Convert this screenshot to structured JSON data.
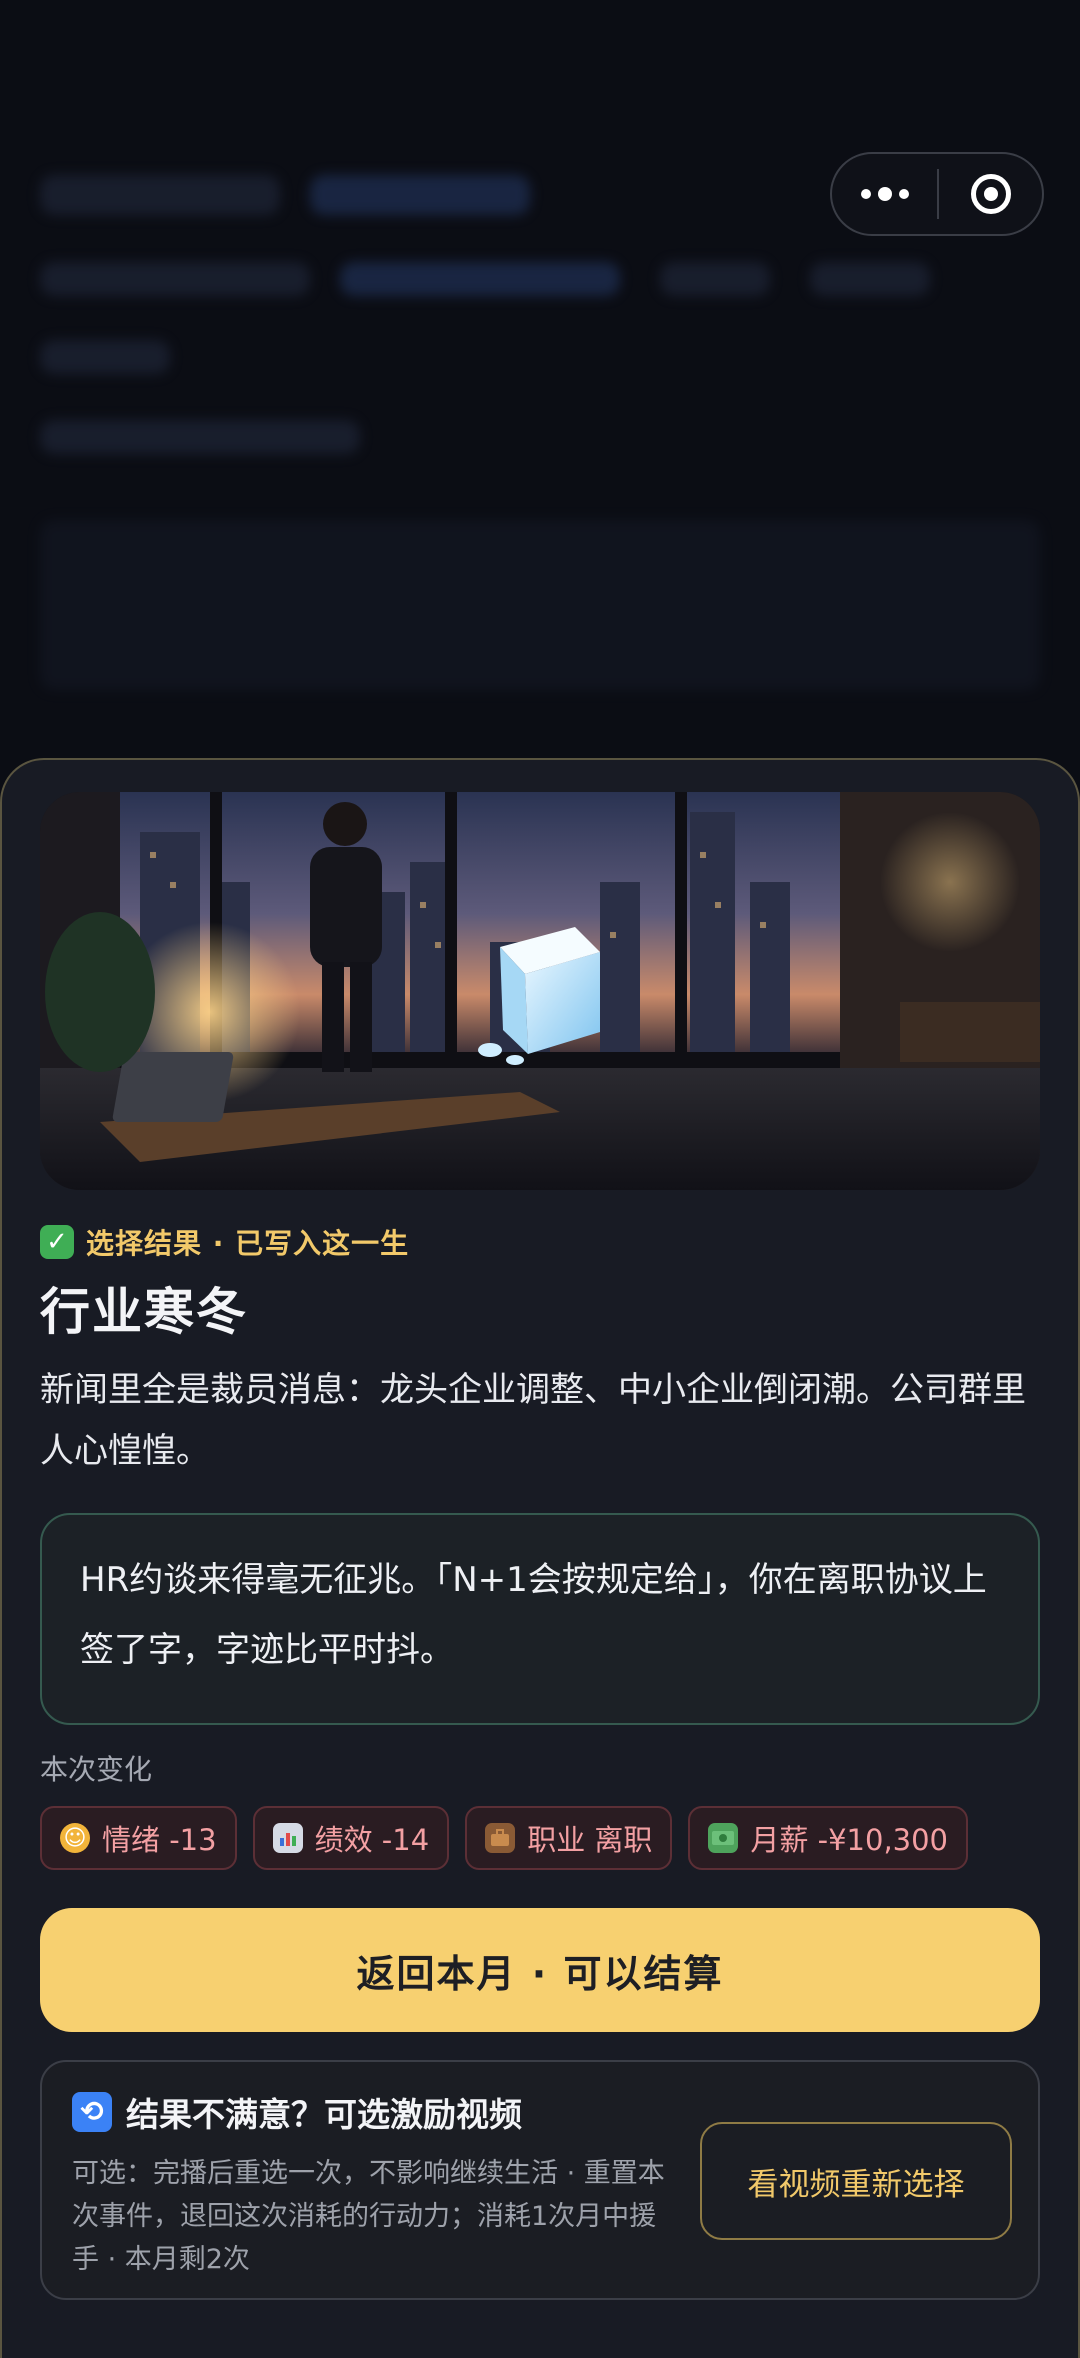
{
  "result": {
    "tag": "选择结果 · 已写入这一生",
    "title": "行业寒冬",
    "description": "新闻里全是裁员消息：龙头企业调整、中小企业倒闭潮。公司群里人心惶惶。",
    "quote": "HR约谈来得毫无征兆。「N+1会按规定给」，你在离职协议上签了字，字迹比平时抖。"
  },
  "changes": {
    "label": "本次变化",
    "items": [
      {
        "icon": "smile-emoji-icon",
        "text": "情绪 -13"
      },
      {
        "icon": "bar-chart-icon",
        "text": "绩效 -14"
      },
      {
        "icon": "briefcase-icon",
        "text": "职业 离职"
      },
      {
        "icon": "cash-icon",
        "text": "月薪 -¥10,300"
      }
    ]
  },
  "primary_button": "返回本月 · 可以结算",
  "reroll": {
    "title": "结果不满意？可选激励视频",
    "description": "可选：完播后重选一次，不影响继续生活 · 重置本次事件，退回这次消耗的行动力；消耗1次月中援手 · 本月剩2次",
    "button": "看视频重新选择"
  },
  "colors": {
    "accent_gold": "#f7d070",
    "negative_chip": "#f3a0a3",
    "sheet_bg": "#181b24"
  }
}
